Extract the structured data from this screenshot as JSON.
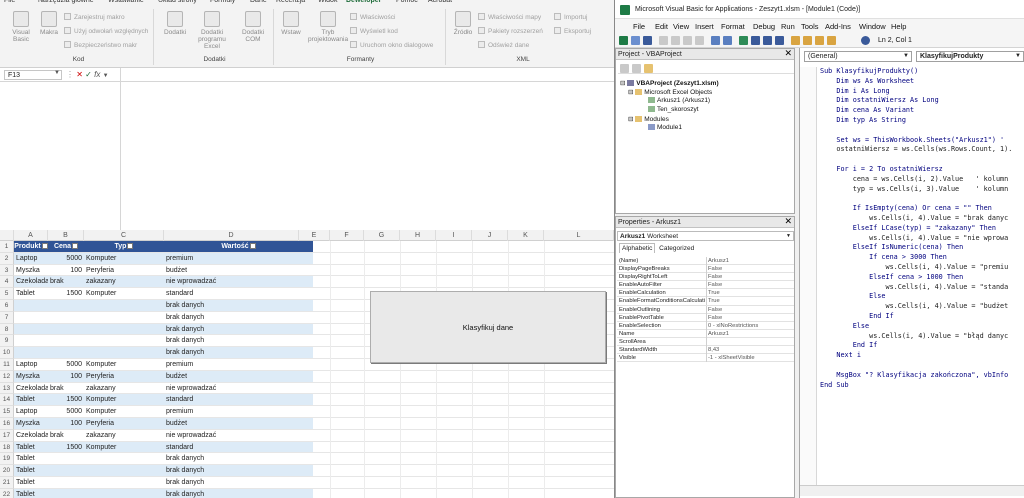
{
  "excel": {
    "tabs": [
      "File",
      "Narzędzia główne",
      "Wstawianie",
      "Układ strony",
      "Formuły",
      "Dane",
      "Recenzja",
      "Widok",
      "Deweloper",
      "Pomoc",
      "Acrobat"
    ],
    "active_tab": "Deweloper",
    "groups": {
      "kod": {
        "label": "Kod",
        "visual_basic": "Visual Basic",
        "makra": "Makra",
        "zarejestruj_makro": "Zarejestruj makro",
        "uzyj_odwolan": "Użyj odwołań względnych",
        "bezpieczenstwo": "Bezpieczeństwo makr"
      },
      "dodatki": {
        "label": "Dodatki",
        "dodatki": "Dodatki",
        "dodatki_programu": "Dodatki programu Excel",
        "dodatki_com": "Dodatki COM"
      },
      "formanty": {
        "label": "Formanty",
        "wstaw": "Wstaw",
        "tryb": "Tryb projektowania",
        "wlasciwosci": "Właściwości",
        "wyswietl_kod": "Wyświetl kod",
        "uruchom_okno": "Uruchom okno dialogowe"
      },
      "xml": {
        "label": "XML",
        "zrodlo": "Źródło",
        "wlasciwosci_mapy": "Właściwości mapy",
        "pakiety": "Pakiety rozszerzeń",
        "odswiez": "Odśwież dane",
        "importuj": "Importuj",
        "eksportuj": "Eksportuj"
      }
    },
    "name_box": "F13",
    "fx_label": "fx",
    "columns": [
      "A",
      "B",
      "C",
      "D",
      "E",
      "F",
      "G",
      "H",
      "I",
      "J",
      "K",
      "L"
    ],
    "table_headers": [
      "Produkt",
      "Cena",
      "Typ",
      "Wartość"
    ],
    "rows": [
      {
        "n": "2",
        "produkt": "Laptop",
        "cena": "5000",
        "typ": "Komputer",
        "wartosc": "premium"
      },
      {
        "n": "3",
        "produkt": "Myszka",
        "cena": "100",
        "typ": "Peryferia",
        "wartosc": "budżet"
      },
      {
        "n": "4",
        "produkt": "Czekolada",
        "cena": "brak",
        "typ": "zakazany",
        "wartosc": "nie wprowadzać"
      },
      {
        "n": "5",
        "produkt": "Tablet",
        "cena": "1500",
        "typ": "Komputer",
        "wartosc": "standard"
      },
      {
        "n": "6",
        "produkt": "",
        "cena": "",
        "typ": "",
        "wartosc": "brak danych"
      },
      {
        "n": "7",
        "produkt": "",
        "cena": "",
        "typ": "",
        "wartosc": "brak danych"
      },
      {
        "n": "8",
        "produkt": "",
        "cena": "",
        "typ": "",
        "wartosc": "brak danych"
      },
      {
        "n": "9",
        "produkt": "",
        "cena": "",
        "typ": "",
        "wartosc": "brak danych"
      },
      {
        "n": "10",
        "produkt": "",
        "cena": "",
        "typ": "",
        "wartosc": "brak danych"
      },
      {
        "n": "11",
        "produkt": "Laptop",
        "cena": "5000",
        "typ": "Komputer",
        "wartosc": "premium"
      },
      {
        "n": "12",
        "produkt": "Myszka",
        "cena": "100",
        "typ": "Peryferia",
        "wartosc": "budżet"
      },
      {
        "n": "13",
        "produkt": "Czekolada",
        "cena": "brak",
        "typ": "zakazany",
        "wartosc": "nie wprowadzać"
      },
      {
        "n": "14",
        "produkt": "Tablet",
        "cena": "1500",
        "typ": "Komputer",
        "wartosc": "standard"
      },
      {
        "n": "15",
        "produkt": "Laptop",
        "cena": "5000",
        "typ": "Komputer",
        "wartosc": "premium"
      },
      {
        "n": "16",
        "produkt": "Myszka",
        "cena": "100",
        "typ": "Peryferia",
        "wartosc": "budżet"
      },
      {
        "n": "17",
        "produkt": "Czekolada",
        "cena": "brak",
        "typ": "zakazany",
        "wartosc": "nie wprowadzać"
      },
      {
        "n": "18",
        "produkt": "Tablet",
        "cena": "1500",
        "typ": "Komputer",
        "wartosc": "standard"
      },
      {
        "n": "19",
        "produkt": "Tablet",
        "cena": "",
        "typ": "",
        "wartosc": "brak danych"
      },
      {
        "n": "20",
        "produkt": "Tablet",
        "cena": "",
        "typ": "",
        "wartosc": "brak danych"
      },
      {
        "n": "21",
        "produkt": "Tablet",
        "cena": "",
        "typ": "",
        "wartosc": "brak danych"
      },
      {
        "n": "22",
        "produkt": "Tablet",
        "cena": "",
        "typ": "",
        "wartosc": "brak danych"
      }
    ],
    "button_label": "Klasyfikuj dane"
  },
  "vba": {
    "title": "Microsoft Visual Basic for Applications - Zeszyt1.xlsm - [Module1 (Code)]",
    "menu": [
      "File",
      "Edit",
      "View",
      "Insert",
      "Format",
      "Debug",
      "Run",
      "Tools",
      "Add-Ins",
      "Window",
      "Help"
    ],
    "ln_col": "Ln 2, Col 1",
    "project_panel": {
      "title": "Project - VBAProject",
      "root": "VBAProject (Zeszyt1.xlsm)",
      "excel_objects": "Microsoft Excel Objects",
      "sheet1": "Arkusz1 (Arkusz1)",
      "ten_skoroszyt": "Ten_skoroszyt",
      "modules": "Modules",
      "module1": "Module1"
    },
    "properties_panel": {
      "title": "Properties - Arkusz1",
      "object": "Arkusz1",
      "object_type": "Worksheet",
      "tab_alpha": "Alphabetic",
      "tab_cat": "Categorized",
      "props": [
        [
          "(Name)",
          "Arkusz1"
        ],
        [
          "DisplayPageBreaks",
          "False"
        ],
        [
          "DisplayRightToLeft",
          "False"
        ],
        [
          "EnableAutoFilter",
          "False"
        ],
        [
          "EnableCalculation",
          "True"
        ],
        [
          "EnableFormatConditionsCalculati",
          "True"
        ],
        [
          "EnableOutlining",
          "False"
        ],
        [
          "EnablePivotTable",
          "False"
        ],
        [
          "EnableSelection",
          "0 - xlNoRestrictions"
        ],
        [
          "Name",
          "Arkusz1"
        ],
        [
          "ScrollArea",
          ""
        ],
        [
          "StandardWidth",
          "8,43"
        ],
        [
          "Visible",
          "-1 - xlSheetVisible"
        ]
      ]
    },
    "combo_general": "(General)",
    "combo_proc": "KlasyfikujProdukty",
    "code": [
      "Sub KlasyfikujProdukty()",
      "    Dim ws As Worksheet",
      "    Dim i As Long",
      "    Dim ostatniWiersz As Long",
      "    Dim cena As Variant",
      "    Dim typ As String",
      "",
      "    Set ws = ThisWorkbook.Sheets(\"Arkusz1\") '",
      "    ostatniWiersz = ws.Cells(ws.Rows.Count, 1).",
      "",
      "    For i = 2 To ostatniWiersz",
      "        cena = ws.Cells(i, 2).Value   ' kolumn",
      "        typ = ws.Cells(i, 3).Value    ' kolumn",
      "",
      "        If IsEmpty(cena) Or cena = \"\" Then",
      "            ws.Cells(i, 4).Value = \"brak danyc",
      "        ElseIf LCase(typ) = \"zakazany\" Then",
      "            ws.Cells(i, 4).Value = \"nie wprowa",
      "        ElseIf IsNumeric(cena) Then",
      "            If cena > 3000 Then",
      "                ws.Cells(i, 4).Value = \"premiu",
      "            ElseIf cena > 1000 Then",
      "                ws.Cells(i, 4).Value = \"standa",
      "            Else",
      "                ws.Cells(i, 4).Value = \"budżet",
      "            End If",
      "        Else",
      "            ws.Cells(i, 4).Value = \"błąd danyc",
      "        End If",
      "    Next i",
      "",
      "    MsgBox \"? Klasyfikacja zakończona\", vbInfo",
      "End Sub"
    ]
  },
  "colors": {
    "table_header": "#305496",
    "table_band": "#ddebf7",
    "excel_accent": "#1d6b39",
    "vba_keyword": "#00007f",
    "vba_comment": "#007f00"
  }
}
